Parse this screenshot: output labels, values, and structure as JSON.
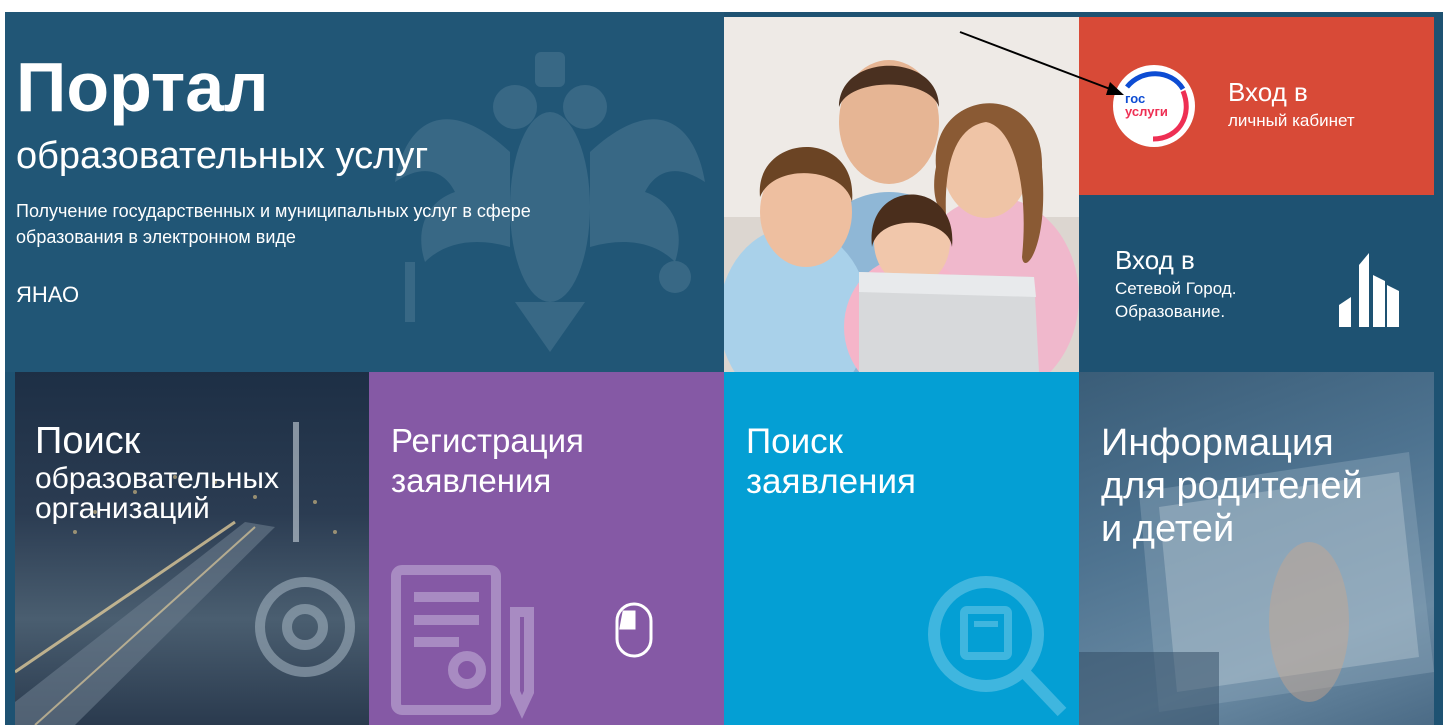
{
  "hero": {
    "title": "Портал",
    "subtitle": "образовательных услуг",
    "description_line1": "Получение государственных и муниципальных услуг в сфере",
    "description_line2": "образования в электронном виде",
    "region": "ЯНАО"
  },
  "gosuslugi_tile": {
    "logo_text_line1": "гос",
    "logo_text_line2": "услуги",
    "title": "Вход в",
    "subtitle": "личный кабинет"
  },
  "network_city_tile": {
    "title": "Вход в",
    "subtitle_line1": "Сетевой Город.",
    "subtitle_line2": "Образование."
  },
  "tiles": {
    "search_orgs": {
      "line1": "Поиск",
      "line2": "образовательных",
      "line3": "организаций"
    },
    "registration": {
      "line1": "Регистрация",
      "line2": "заявления"
    },
    "search_application": {
      "line1": "Поиск",
      "line2": "заявления"
    },
    "info": {
      "line1": "Информация",
      "line2": "для родителей",
      "line3": "и детей"
    }
  },
  "colors": {
    "hero_bg": "#215676",
    "gosuslugi_bg": "#d84a37",
    "network_bg": "#1e5272",
    "registration_bg": "#8559a5",
    "search_application_bg": "#049fd4"
  },
  "icons": {
    "hero": "russian-emblem-icon",
    "gosuslugi": "gosuslugi-logo-icon",
    "network": "network-city-logo-icon",
    "registration": "document-pen-icon",
    "mouse": "mouse-icon",
    "search": "magnifier-newspaper-icon",
    "orgs": "location-pin-icon"
  }
}
